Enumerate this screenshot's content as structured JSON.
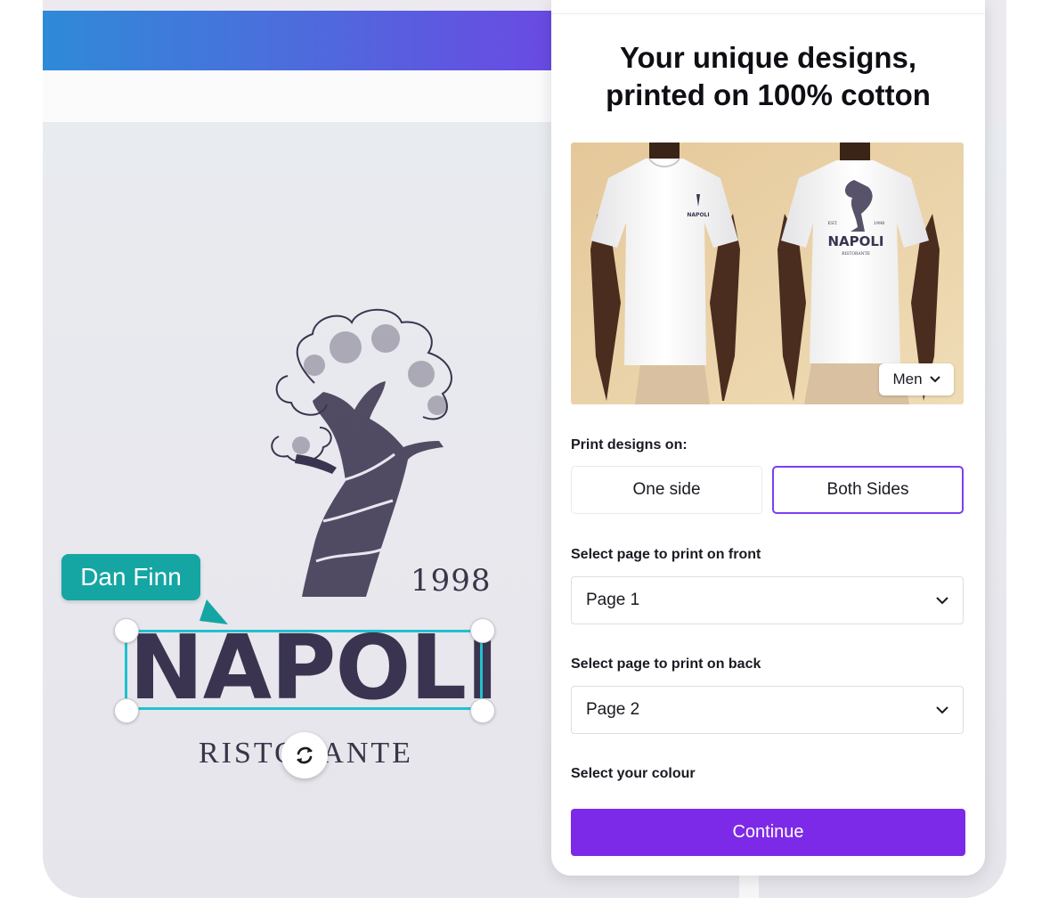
{
  "canvas": {
    "year": "1998",
    "brand_name": "NAPOLI",
    "brand_sub": "RISTORANTE",
    "collaborator_name": "Dan Finn"
  },
  "panel": {
    "title_line1": "Your unique designs,",
    "title_line2": "printed on 100% cotton",
    "shirt_preview": {
      "front_logo": "NAPOLI",
      "back_logo": "NAPOLI",
      "back_logo_sub": "RISTORANTE",
      "back_logo_est": "EST.",
      "back_logo_year": "1998"
    },
    "gender_dropdown": {
      "value": "Men",
      "icon": "chevron-down-icon"
    },
    "print_designs_label": "Print designs on:",
    "print_options": [
      {
        "label": "One side",
        "selected": false
      },
      {
        "label": "Both Sides",
        "selected": true
      }
    ],
    "front_page_label": "Select page to print on front",
    "front_page_value": "Page 1",
    "back_page_label": "Select page to print on back",
    "back_page_value": "Page 2",
    "colour_label": "Select your colour",
    "continue_label": "Continue"
  },
  "colors": {
    "accent_purple": "#7d2ae8",
    "selection_cyan": "#20c1cf",
    "collab_teal": "#15a6a4",
    "logo_ink": "#3b3450"
  }
}
